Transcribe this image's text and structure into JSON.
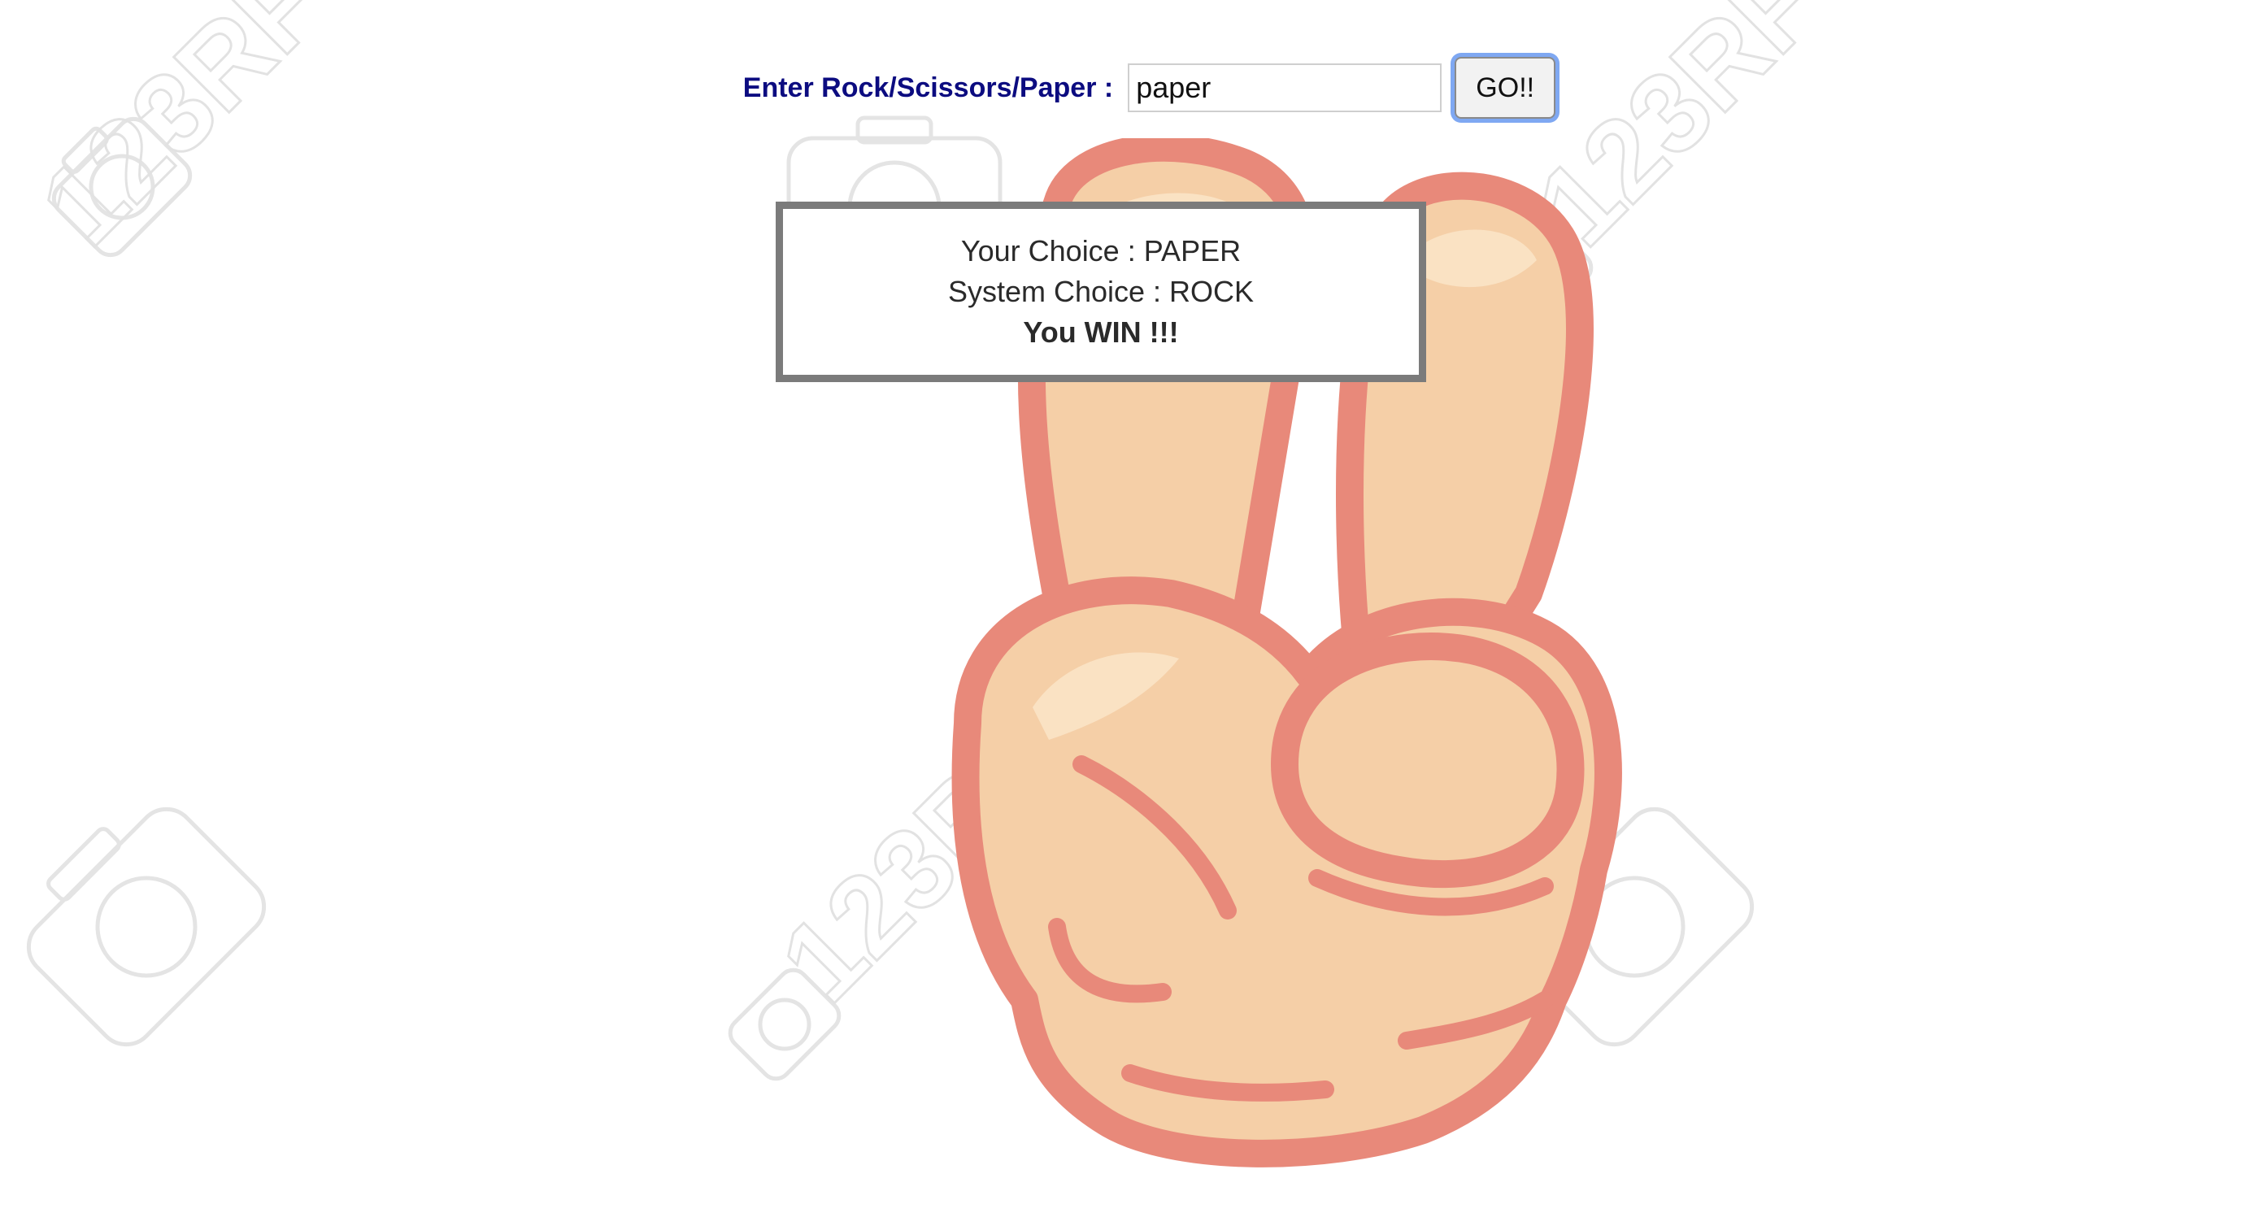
{
  "form": {
    "prompt_label": "Enter Rock/Scissors/Paper :",
    "input_value": "paper",
    "go_label": "GO!!"
  },
  "result": {
    "your_choice": "Your Choice : PAPER",
    "system_choice": "System Choice : ROCK",
    "verdict": "You WIN !!!"
  },
  "illustration": {
    "subject": "peace-sign-hand",
    "skin_color": "#f5cfa7",
    "outline_color": "#e8897a",
    "highlight_color": "#fbe3c6"
  },
  "watermark": {
    "text": "123RF"
  },
  "colors": {
    "label_color": "#0c0c80",
    "focus_ring": "#7fa8f2",
    "box_border": "#7b7b7b"
  }
}
